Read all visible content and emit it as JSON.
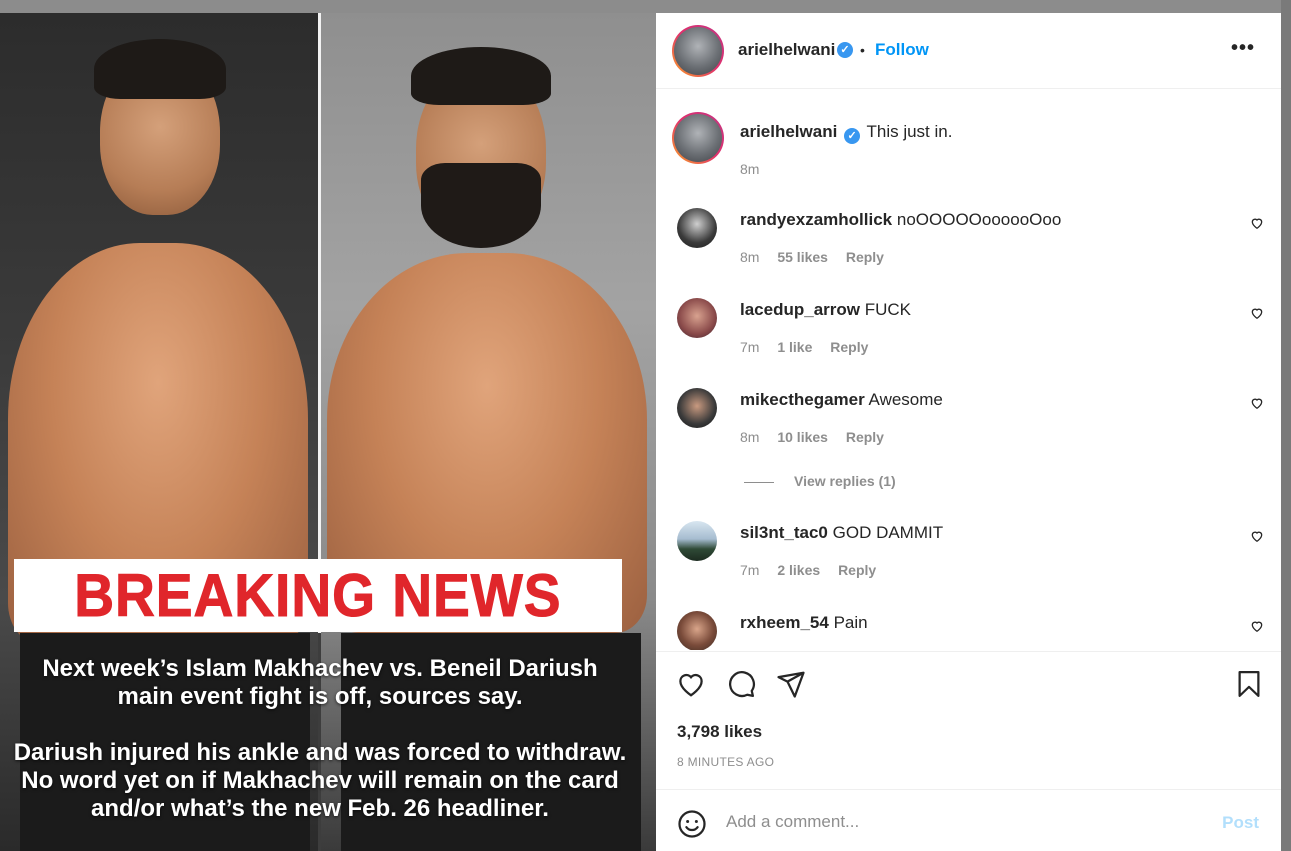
{
  "post": {
    "author": "arielhelwani",
    "follow_label": "Follow",
    "separator": "•",
    "more_label": "•••",
    "caption_text": "This just in.",
    "caption_time": "8m",
    "likes": "3,798 likes",
    "time_ago": "8 MINUTES AGO"
  },
  "image": {
    "headline": "BREAKING NEWS",
    "text1_line1": "Next week’s Islam Makhachev vs. Beneil Dariush",
    "text1_line2": "main event fight is off, sources say.",
    "text2_line1": "Dariush injured his ankle and was forced to withdraw.",
    "text2_line2": "No word yet on if Makhachev will remain on the card",
    "text2_line3": "and/or what’s the new Feb. 26 headliner."
  },
  "comments": [
    {
      "user": "randyexzamhollick",
      "text": "noOOOOOoooooOoo",
      "time": "8m",
      "likes": "55 likes",
      "reply": "Reply"
    },
    {
      "user": "lacedup_arrow",
      "text": "FUCK",
      "time": "7m",
      "likes": "1 like",
      "reply": "Reply"
    },
    {
      "user": "mikecthegamer",
      "text": "Awesome",
      "time": "8m",
      "likes": "10 likes",
      "reply": "Reply"
    },
    {
      "user": "sil3nt_tac0",
      "text": "GOD DAMMIT",
      "time": "7m",
      "likes": "2 likes",
      "reply": "Reply"
    },
    {
      "user": "rxheem_54",
      "text": "Pain",
      "time": "",
      "likes": "",
      "reply": ""
    }
  ],
  "view_replies": "View replies (1)",
  "add_comment": {
    "placeholder": "Add a comment...",
    "post_label": "Post"
  },
  "colors": {
    "accent": "#0095f6",
    "verified": "#3897f0",
    "breaking_red": "#e0262b",
    "post_disabled": "#b2dffc"
  }
}
